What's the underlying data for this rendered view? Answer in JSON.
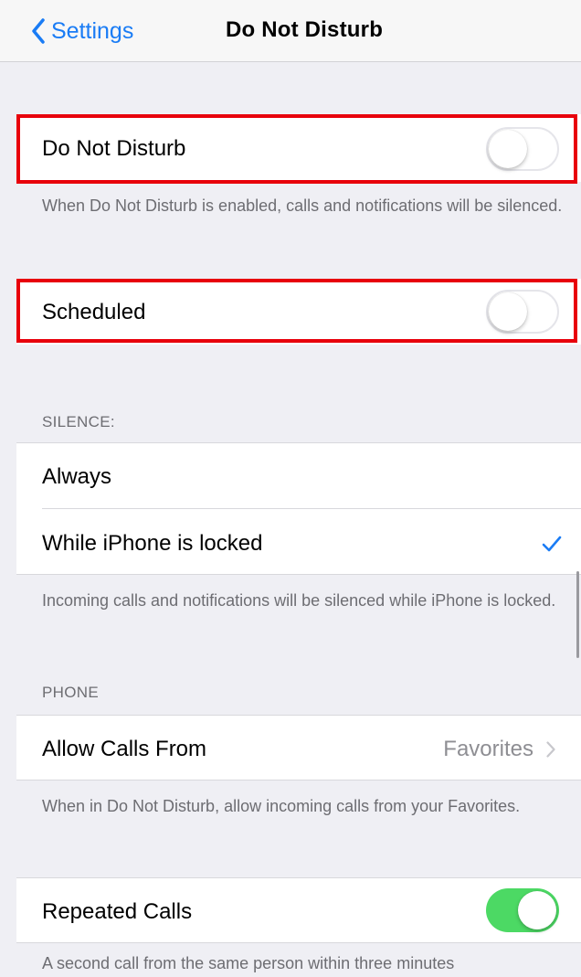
{
  "navbar": {
    "back_label": "Settings",
    "title": "Do Not Disturb"
  },
  "do_not_disturb": {
    "label": "Do Not Disturb",
    "enabled": false,
    "footer": "When Do Not Disturb is enabled, calls and notifications will be silenced."
  },
  "scheduled": {
    "label": "Scheduled",
    "enabled": false
  },
  "silence": {
    "header": "SILENCE:",
    "options": [
      {
        "label": "Always",
        "selected": false
      },
      {
        "label": "While iPhone is locked",
        "selected": true
      }
    ],
    "footer": "Incoming calls and notifications will be silenced while iPhone is locked."
  },
  "phone": {
    "header": "PHONE",
    "allow_calls_from": {
      "label": "Allow Calls From",
      "value": "Favorites"
    },
    "footer": "When in Do Not Disturb, allow incoming calls from your Favorites."
  },
  "repeated_calls": {
    "label": "Repeated Calls",
    "enabled": true,
    "footer": "A second call from the same person within three minutes"
  },
  "colors": {
    "accent": "#1a7cf5",
    "toggle_on": "#4cd964",
    "highlight": "#e8000b",
    "background": "#efeff4"
  }
}
